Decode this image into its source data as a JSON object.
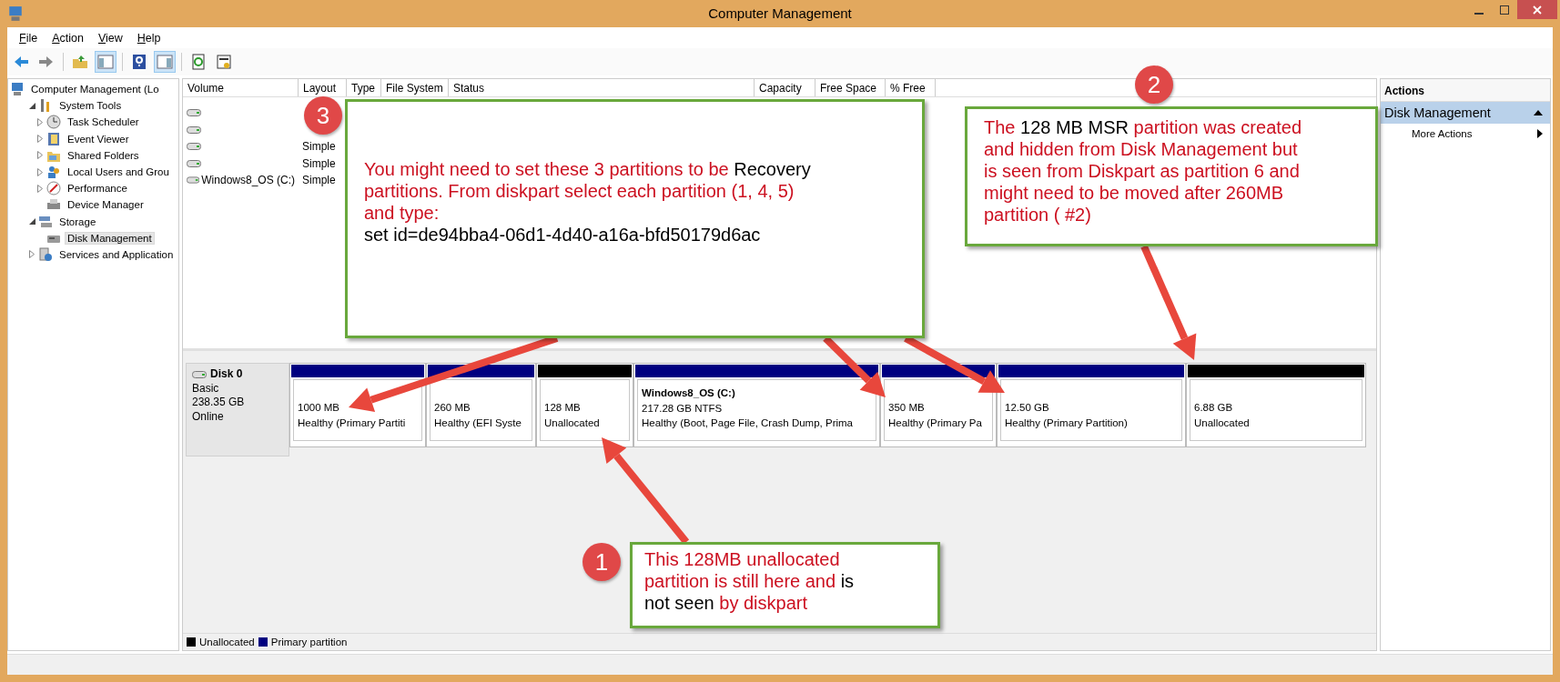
{
  "window": {
    "title": "Computer Management"
  },
  "menu": [
    {
      "label": "File"
    },
    {
      "label": "Action"
    },
    {
      "label": "View"
    },
    {
      "label": "Help"
    }
  ],
  "toolbar": [
    {
      "pressed": false
    },
    {
      "pressed": false
    },
    {
      "pressed": false
    },
    {
      "pressed": true
    },
    {
      "pressed": false
    },
    {
      "pressed": true
    },
    {
      "pressed": false
    },
    {
      "pressed": false
    }
  ],
  "tree": [
    {
      "label": "Computer Management (Lo",
      "selected": false,
      "children": [
        {
          "label": "System Tools",
          "expanded": true,
          "selected": false,
          "children": [
            {
              "label": "Task Scheduler",
              "expanded": false,
              "selected": false
            },
            {
              "label": "Event Viewer",
              "expanded": false,
              "selected": false
            },
            {
              "label": "Shared Folders",
              "expanded": false,
              "selected": false
            },
            {
              "label": "Local Users and Grou",
              "expanded": false,
              "selected": false
            },
            {
              "label": "Performance",
              "expanded": false,
              "selected": false
            },
            {
              "label": "Device Manager",
              "selected": false
            }
          ]
        },
        {
          "label": "Storage",
          "expanded": true,
          "selected": false,
          "children": [
            {
              "label": "Disk Management",
              "selected": true
            }
          ]
        },
        {
          "label": "Services and Application",
          "expanded": false,
          "selected": false
        }
      ]
    }
  ],
  "volumes": {
    "columns": [
      "Volume",
      "Layout",
      "Type",
      "File System",
      "Status",
      "Capacity",
      "Free Space",
      "% Free"
    ],
    "rows": [
      {},
      {},
      {
        "layout": "Simple"
      },
      {
        "layout": "Simple"
      },
      {
        "volume": "Windows8_OS (C:)",
        "layout": "Simple"
      }
    ]
  },
  "disks": [
    {
      "name": "Disk 0",
      "type": "Basic",
      "size": "238.35 GB",
      "status": "Online",
      "partitions": [
        {
          "kind": "primary",
          "size": "1000 MB",
          "status": "Healthy (Primary Partiti"
        },
        {
          "kind": "primary",
          "size": "260 MB",
          "status": "Healthy (EFI Syste"
        },
        {
          "kind": "unallocated",
          "size": "128 MB",
          "status": "Unallocated"
        },
        {
          "kind": "primary",
          "name": "Windows8_OS  (C:)",
          "size": "217.28 GB NTFS",
          "status": "Healthy (Boot, Page File, Crash Dump, Prima"
        },
        {
          "kind": "primary",
          "size": "350 MB",
          "status": "Healthy (Primary Pa"
        },
        {
          "kind": "primary",
          "size": "12.50 GB",
          "status": "Healthy (Primary Partition)"
        },
        {
          "kind": "unallocated",
          "size": "6.88 GB",
          "status": "Unallocated"
        }
      ]
    }
  ],
  "legend": [
    {
      "label": "Unallocated",
      "color": "#000000"
    },
    {
      "label": "Primary partition",
      "color": "#000080"
    }
  ],
  "actions": {
    "title": "Actions",
    "section": {
      "label": "Disk Management",
      "expanded": true
    },
    "items": [
      {
        "label": "More Actions"
      }
    ]
  },
  "callouts": [
    {
      "number": "3",
      "lines": [
        [
          {
            "text": "You might need to set these 3 partitions to be ",
            "color": "#cc1020"
          },
          {
            "text": "Recovery",
            "color": "#000000"
          }
        ],
        [
          {
            "text": "partitions. From diskpart select each partition (1, 4, 5)",
            "color": "#cc1020"
          }
        ],
        [
          {
            "text": "and type:",
            "color": "#cc1020"
          }
        ],
        [
          {
            "text": "set id=de94bba4-06d1-4d40-a16a-bfd50179d6ac",
            "color": "#000000"
          }
        ]
      ]
    },
    {
      "number": "2",
      "lines": [
        [
          {
            "text": "The ",
            "color": "#cc1020"
          },
          {
            "text": "128 MB MSR",
            "color": "#000000"
          },
          {
            "text": " partition was created",
            "color": "#cc1020"
          }
        ],
        [
          {
            "text": "and hidden from Disk Management but",
            "color": "#cc1020"
          }
        ],
        [
          {
            "text": "is seen from Diskpart as partition 6 and",
            "color": "#cc1020"
          }
        ],
        [
          {
            "text": "might need to be moved after 260MB",
            "color": "#cc1020"
          }
        ],
        [
          {
            "text": "partition ( #2)",
            "color": "#cc1020"
          }
        ]
      ]
    },
    {
      "number": "1",
      "lines": [
        [
          {
            "text": "This 128MB unallocated",
            "color": "#cc1020"
          }
        ],
        [
          {
            "text": "partition is still here and ",
            "color": "#cc1020"
          },
          {
            "text": "is",
            "color": "#000000"
          }
        ],
        [
          {
            "text": "not seen ",
            "color": "#000000"
          },
          {
            "text": "by diskpart",
            "color": "#cc1020"
          }
        ]
      ]
    }
  ]
}
